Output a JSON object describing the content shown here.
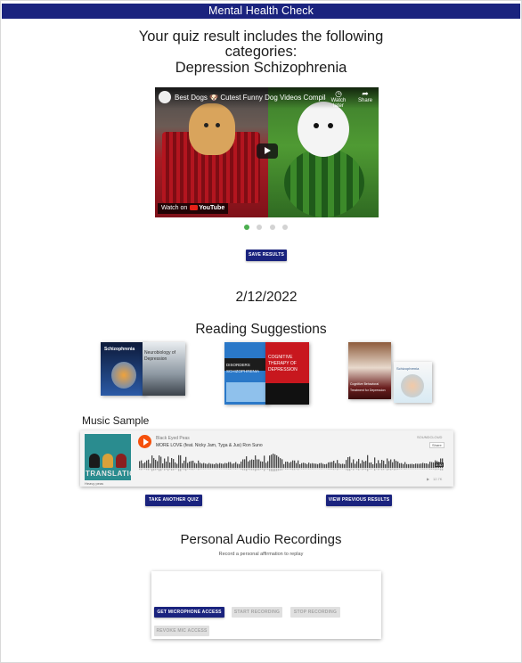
{
  "header": {
    "title": "Mental Health Check"
  },
  "result": {
    "line1": "Your quiz result includes the following",
    "line2": "categories:",
    "line3": "Depression Schizophrenia"
  },
  "video": {
    "title": "Best Dogs 🐶 Cutest Funny Dog Videos Compilatio...",
    "watch_later": "Watch later",
    "share": "Share",
    "watch_on": "Watch on",
    "youtube": "YouTube"
  },
  "carousel": {
    "slides": 4,
    "active_index": 0,
    "active_color": "#4caf50"
  },
  "actions": {
    "save_results": "SAVE RESULTS",
    "take_another_quiz": "TAKE ANOTHER QUIZ",
    "view_previous_results": "VIEW PREVIOUS RESULTS"
  },
  "date": "2/12/2022",
  "reading": {
    "title": "Reading Suggestions",
    "books": [
      {
        "title": "Schizophrenia"
      },
      {
        "title": "Neurobiology of Depression"
      },
      {
        "title": "DISORDERS SCHIZOPHRENIA"
      },
      {
        "title": "COGNITIVE THERAPY OF DEPRESSION"
      },
      {
        "title": "Cognitive Behavioral Treatment for Depression"
      },
      {
        "title": "Schizophrenia"
      }
    ]
  },
  "music": {
    "label": "Music Sample",
    "artist": "Black Eyed Peas",
    "track": "MORE LOVE (feat. Nicky Jam, Tyga & Jus)  Ron Suno",
    "cover_title": "TRANSLATION",
    "cover_credit": "Heavy peas",
    "soundcloud": "SOUNDCLOUD",
    "share": "Share",
    "time": "3:30",
    "plays": "12.7K"
  },
  "recordings": {
    "title": "Personal Audio Recordings",
    "subtitle": "Record a personal affirmation to replay",
    "get_mic": "GET MICROPHONE ACCESS",
    "start": "START RECORDING",
    "stop": "STOP RECORDING",
    "revoke": "REVOKE MIC ACCESS"
  },
  "colors": {
    "primary": "#1a237e",
    "soundcloud": "#f5500b",
    "disabled": "#e0e0e0"
  }
}
